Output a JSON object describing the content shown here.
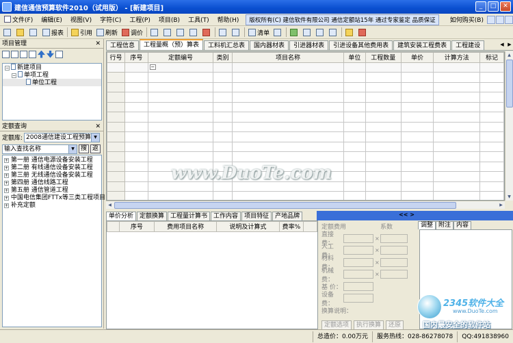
{
  "window": {
    "title": "建信通信预算软件2010（试用版） - [新建项目]",
    "minimize": "_",
    "maximize": "□",
    "close": "✕"
  },
  "menu": {
    "items": [
      "文件(F)",
      "编辑(E)",
      "视图(V)",
      "字符(C)",
      "工程(P)",
      "项目(B)",
      "工具(T)",
      "帮助(H)"
    ],
    "banner": "版权所有(C) 建信软件有限公司 通信定额站15年 通过专家鉴定 品质保证",
    "buy": "如何购买(B)"
  },
  "toolbar": {
    "report": "报表",
    "quote": "引用",
    "refresh": "刷新",
    "adjust": "调价",
    "list": "清单"
  },
  "project_panel": {
    "title": "项目管理",
    "close": "✕",
    "tree": [
      {
        "label": "新建项目",
        "level": 0,
        "expander": "−"
      },
      {
        "label": "单项工程",
        "level": 1,
        "expander": "−"
      },
      {
        "label": "单位工程",
        "level": 2,
        "expander": ""
      }
    ]
  },
  "quota_panel": {
    "title": "定额查询",
    "close": "✕",
    "library_label": "定额库:",
    "library_value": "2008通信建设工程预算",
    "search_placeholder": "输入查找名称",
    "search_button": "搜",
    "back_button": "返",
    "tree": [
      "第一册 通信电源设备安装工程",
      "第二册 有线通信设备安装工程",
      "第三册 无线通信设备安装工程",
      "第四册 通信线路工程",
      "第五册 通信管道工程",
      "中国电信集团FTTx等三类工程项目",
      "补充定额"
    ]
  },
  "main_tabs": [
    "工程信息",
    "工程量概（预）算表",
    "工料机汇总表",
    "国内器材表",
    "引进器材表",
    "引进设备其他费用表",
    "建筑安装工程费表",
    "工程建设"
  ],
  "main_tab_active": 1,
  "grid": {
    "headers": [
      "行号",
      "序号",
      "定额编号",
      "类别",
      "项目名称",
      "单位",
      "工程数量",
      "单价",
      "计算方法",
      "标记"
    ],
    "first_row_marker": "−",
    "row_count": 15
  },
  "bottom_tabs": [
    "单价分析",
    "定额换算",
    "工程量计算书",
    "工作内容",
    "项目特征",
    "产地品牌"
  ],
  "bottom_grid": {
    "headers": [
      "序号",
      "费用项目名称",
      "说明及计算式",
      "费率%"
    ]
  },
  "fee_form": {
    "title": "定额费用",
    "coef_label": "系数",
    "rows": [
      "直接费：",
      "人工费：",
      "材料费：",
      "机械费：",
      "基  价：",
      "设备费："
    ],
    "note": "换算说明：",
    "buttons": [
      "定额选项",
      "执行换算",
      "还原"
    ],
    "mul": "×"
  },
  "right_tabs": [
    "调整",
    "附注",
    "内容"
  ],
  "pager_arrows": "<< >",
  "status": {
    "total": "总造价：0.00万元",
    "hotline": "服务热线：028-86278078",
    "qq": "QQ:491838960"
  },
  "watermark": "www.DuoTe.com",
  "logo": {
    "brand": "2345软件大全",
    "site": "www.DuoTe.com",
    "slogan": "国内最安全的软件站"
  }
}
